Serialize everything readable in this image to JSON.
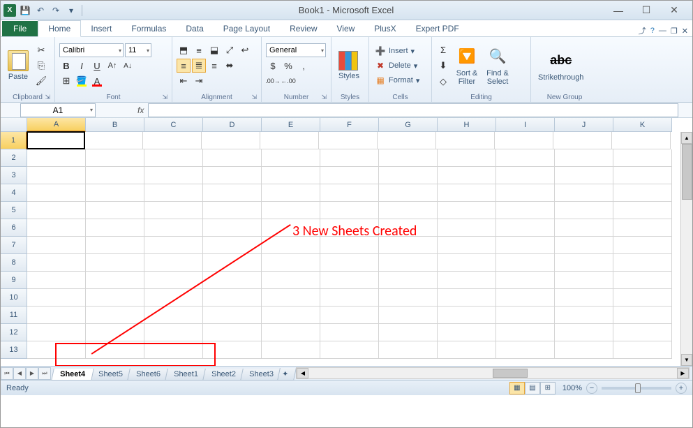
{
  "title": "Book1 - Microsoft Excel",
  "qat": {
    "save": "💾",
    "undo": "↶",
    "redo": "↷"
  },
  "tabs": {
    "file": "File",
    "items": [
      "Home",
      "Insert",
      "Formulas",
      "Data",
      "Page Layout",
      "Review",
      "View",
      "PlusX",
      "Expert PDF"
    ],
    "active": "Home"
  },
  "ribbon": {
    "clipboard": {
      "label": "Clipboard",
      "paste": "Paste"
    },
    "font": {
      "label": "Font",
      "name": "Calibri",
      "size": "11"
    },
    "alignment": {
      "label": "Alignment"
    },
    "number": {
      "label": "Number",
      "format": "General"
    },
    "styles": {
      "label": "Styles",
      "btn": "Styles"
    },
    "cells": {
      "label": "Cells",
      "insert": "Insert",
      "delete": "Delete",
      "format": "Format"
    },
    "editing": {
      "label": "Editing",
      "sort": "Sort &\nFilter",
      "find": "Find &\nSelect"
    },
    "newgroup": {
      "label": "New Group",
      "strike": "Strikethrough"
    }
  },
  "namebox": "A1",
  "columns": [
    "A",
    "B",
    "C",
    "D",
    "E",
    "F",
    "G",
    "H",
    "I",
    "J",
    "K"
  ],
  "rows": [
    "1",
    "2",
    "3",
    "4",
    "5",
    "6",
    "7",
    "8",
    "9",
    "10",
    "11",
    "12",
    "13"
  ],
  "active_cell": {
    "row": 0,
    "col": 0
  },
  "annotation": {
    "text": "3 New Sheets Created"
  },
  "sheets": {
    "items": [
      "Sheet4",
      "Sheet5",
      "Sheet6",
      "Sheet1",
      "Sheet2",
      "Sheet3"
    ],
    "active": "Sheet4"
  },
  "status": {
    "ready": "Ready",
    "zoom": "100%"
  }
}
